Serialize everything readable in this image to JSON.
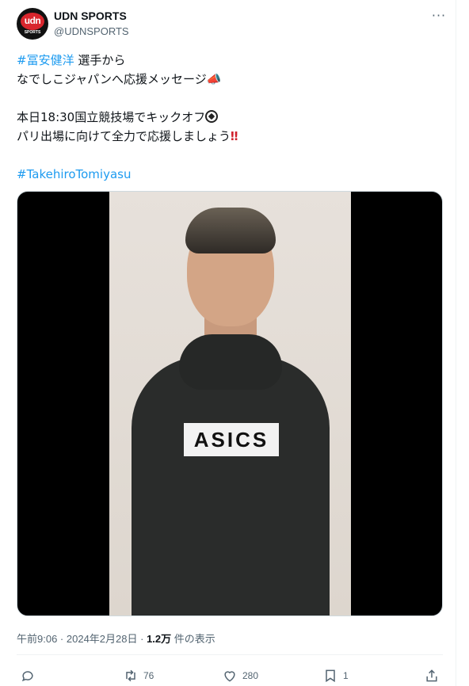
{
  "account": {
    "display_name": "UDN SPORTS",
    "handle": "@UDNSPORTS",
    "avatar_text": "udn",
    "avatar_subtext": "SPORTS"
  },
  "more_label": "···",
  "tweet": {
    "line1_hashtag": "#冨安健洋",
    "line1_text": " 選手から",
    "line2_text": "なでしこジャパンへ応援メッセージ📣",
    "line3_text": "本日18:30国立競技場でキックオフ",
    "line4_text": "パリ出場に向けて全力で応援しましょう",
    "line4_emoji": "‼",
    "line5_hashtag": "#TakehiroTomiyasu"
  },
  "media": {
    "shirt_logo": "ASICS"
  },
  "meta": {
    "time": "午前9:06",
    "sep1": " · ",
    "date": "2024年2月28日",
    "sep2": " · ",
    "views": "1.2万",
    "views_suffix": " 件の表示"
  },
  "actions": {
    "reply_count": "",
    "retweet_count": "76",
    "like_count": "280",
    "bookmark_count": "1"
  },
  "colors": {
    "accent": "#1d9bf0",
    "text": "#0f1419",
    "muted": "#536471",
    "avatar_red": "#d8262d"
  }
}
